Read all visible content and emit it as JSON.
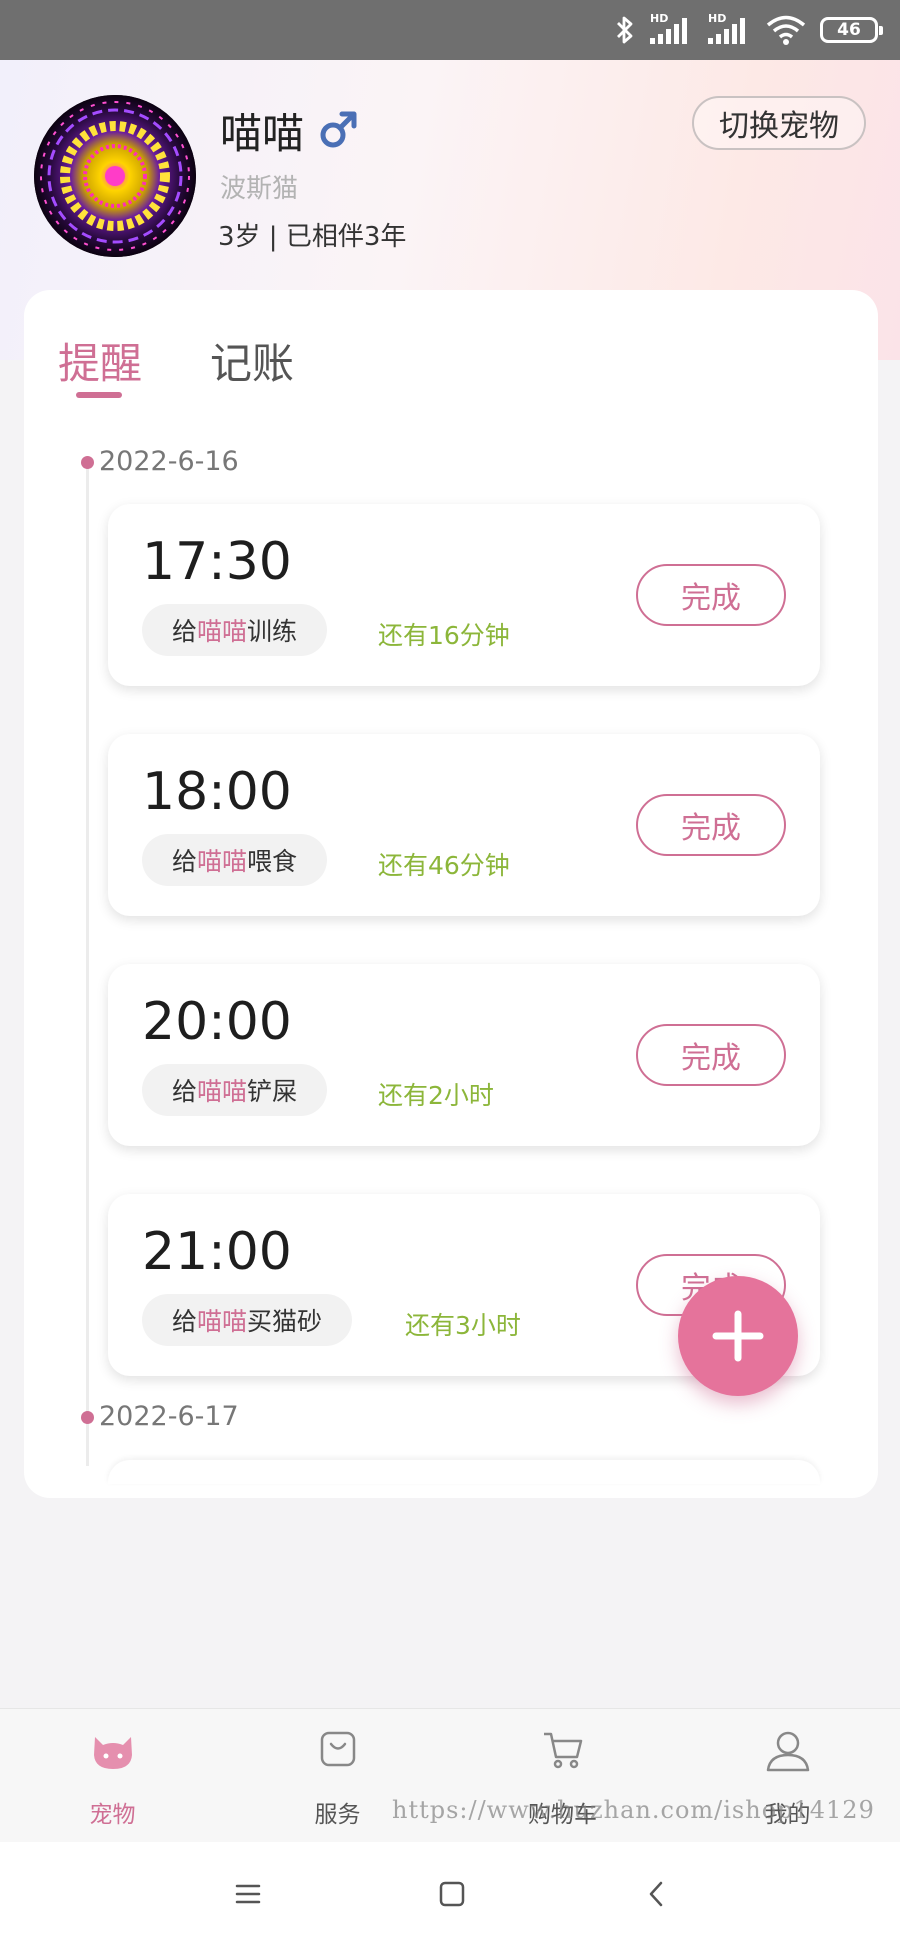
{
  "status_bar": {
    "battery": "46",
    "network_badge_1": "HD",
    "network_badge_2": "HD",
    "icons": [
      "bluetooth-icon",
      "signal-hd-icon",
      "signal-hd-icon",
      "wifi-icon",
      "battery-icon"
    ]
  },
  "pet": {
    "name": "喵喵",
    "gender_icon": "male-icon",
    "breed": "波斯猫",
    "age_info": "3岁 | 已相伴3年",
    "switch_label": "切换宠物"
  },
  "tabs": [
    {
      "label": "提醒",
      "active": true
    },
    {
      "label": "记账",
      "active": false
    }
  ],
  "timeline": [
    {
      "date": "2022-6-16",
      "reminders": [
        {
          "time": "17:30",
          "prefix": "给",
          "pet": "喵喵",
          "action": "训练",
          "remaining": "还有16分钟",
          "done_label": "完成"
        },
        {
          "time": "18:00",
          "prefix": "给",
          "pet": "喵喵",
          "action": "喂食",
          "remaining": "还有46分钟",
          "done_label": "完成"
        },
        {
          "time": "20:00",
          "prefix": "给",
          "pet": "喵喵",
          "action": "铲屎",
          "remaining": "还有2小时",
          "done_label": "完成"
        },
        {
          "time": "21:00",
          "prefix": "给",
          "pet": "喵喵",
          "action": "买猫砂",
          "remaining": "还有3小时",
          "done_label": "完成"
        }
      ]
    },
    {
      "date": "2022-6-17",
      "reminders": []
    }
  ],
  "fab": {
    "icon": "plus-icon"
  },
  "bottom_tabs": [
    {
      "label": "宠物",
      "icon": "cat-icon",
      "active": true
    },
    {
      "label": "服务",
      "icon": "bag-icon",
      "active": false
    },
    {
      "label": "购物车",
      "icon": "cart-icon",
      "active": false
    },
    {
      "label": "我的",
      "icon": "user-icon",
      "active": false
    }
  ],
  "watermark": "https://www.huzhan.com/ishop14129",
  "colors": {
    "accent": "#cf6f94",
    "fab": "#e5739b",
    "remaining_text": "#8cb63a",
    "male": "#4a6fb5"
  }
}
